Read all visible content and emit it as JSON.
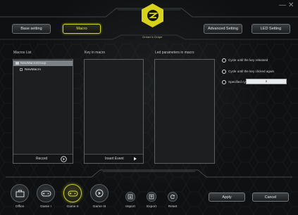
{
  "window": {
    "minimize_glyph": "—",
    "close_glyph": "✕"
  },
  "brand": {
    "logo_icon": "zeus-hexagon-logo",
    "caption": "Dream's Grape",
    "accent_color": "#d7d21c"
  },
  "tabs": [
    {
      "label": "Base setting",
      "active": false
    },
    {
      "label": "Macro",
      "active": true
    },
    {
      "label": "Advanced Setting",
      "active": false
    },
    {
      "label": "LED Setting",
      "active": false
    }
  ],
  "macros_list": {
    "title": "Macros List",
    "items": [
      {
        "label": "NewMacroGroup",
        "selected": true
      },
      {
        "label": "NewMacro",
        "selected": false
      }
    ],
    "footer_label": "Record"
  },
  "key_in_macro": {
    "title": "Key in macro",
    "footer_label": "Insert Event"
  },
  "led_parameters": {
    "title": "Led parameters in macro"
  },
  "cycle_options": [
    {
      "label": "Cycle until the key released"
    },
    {
      "label": "Cycle until the key clicked again"
    },
    {
      "label": "Specified cycle times"
    }
  ],
  "cycle_times_value": "1",
  "profiles": [
    {
      "label": "Office",
      "icon": "briefcase-icon",
      "active": false
    },
    {
      "label": "Game I",
      "icon": "gamepad-icon",
      "active": false
    },
    {
      "label": "Game II",
      "icon": "gamepad-icon",
      "active": true
    },
    {
      "label": "Game III",
      "icon": "play-icon",
      "active": false
    }
  ],
  "file_actions": [
    {
      "label": "Import",
      "icon": "import-icon"
    },
    {
      "label": "Export",
      "icon": "export-icon"
    },
    {
      "label": "Reset",
      "icon": "reset-icon"
    }
  ],
  "buttons": {
    "apply": "Apply",
    "cancel": "Cancel"
  }
}
